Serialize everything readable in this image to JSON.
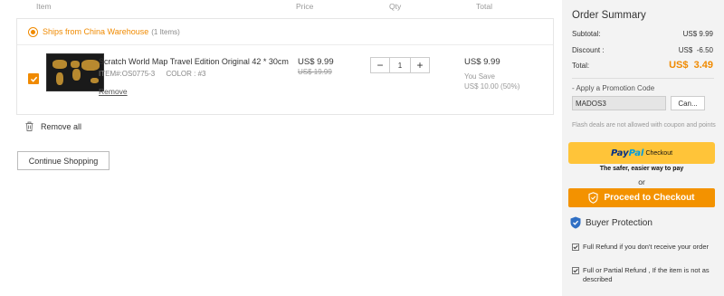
{
  "columns": {
    "item": "Item",
    "price": "Price",
    "qty": "Qty",
    "total": "Total"
  },
  "group": {
    "title": "Ships from China Warehouse",
    "count": "(1 Items)"
  },
  "product": {
    "name": "Scratch World Map Travel Edition Original 42 * 30cm",
    "item_no": "ITEM#:OS0775-3",
    "color": "COLOR : #3",
    "remove_label": "Remove",
    "price": "US$ 9.99",
    "old_price": "US$ 19.99",
    "quantity": "1",
    "minus": "−",
    "plus": "+",
    "total": "US$ 9.99",
    "you_save_label": "You Save",
    "you_save_value": "US$ 10.00 (50%)"
  },
  "remove_all_label": "Remove all",
  "continue_label": "Continue Shopping",
  "summary": {
    "title": "Order Summary",
    "subtotal_label": "Subtotal:",
    "subtotal_value": "US$ 9.99",
    "discount_label": "Discount :",
    "discount_value": "US$  -6.50",
    "total_label": "Total:",
    "total_value": "US$  3.49"
  },
  "promo": {
    "label": "- Apply a Promotion Code",
    "code": "MADOS3",
    "button": "Can..."
  },
  "flash_note": "Flash deals are not allowed with coupon and points",
  "paypal": {
    "pay": "Pay",
    "pal": "Pal",
    "checkout": "Checkout",
    "tagline": "The safer, easier way to pay"
  },
  "or_label": "or",
  "checkout_label": "Proceed to Checkout",
  "buyer_protection": {
    "title": "Buyer Protection",
    "items": [
      "Full Refund if you don't receive your order",
      "Full or Partial Refund , If the item is not as described"
    ]
  },
  "colors": {
    "accent": "#f08a00",
    "checkout": "#f39200",
    "paypal_bg": "#ffc439",
    "shield": "#2f6fc4"
  }
}
